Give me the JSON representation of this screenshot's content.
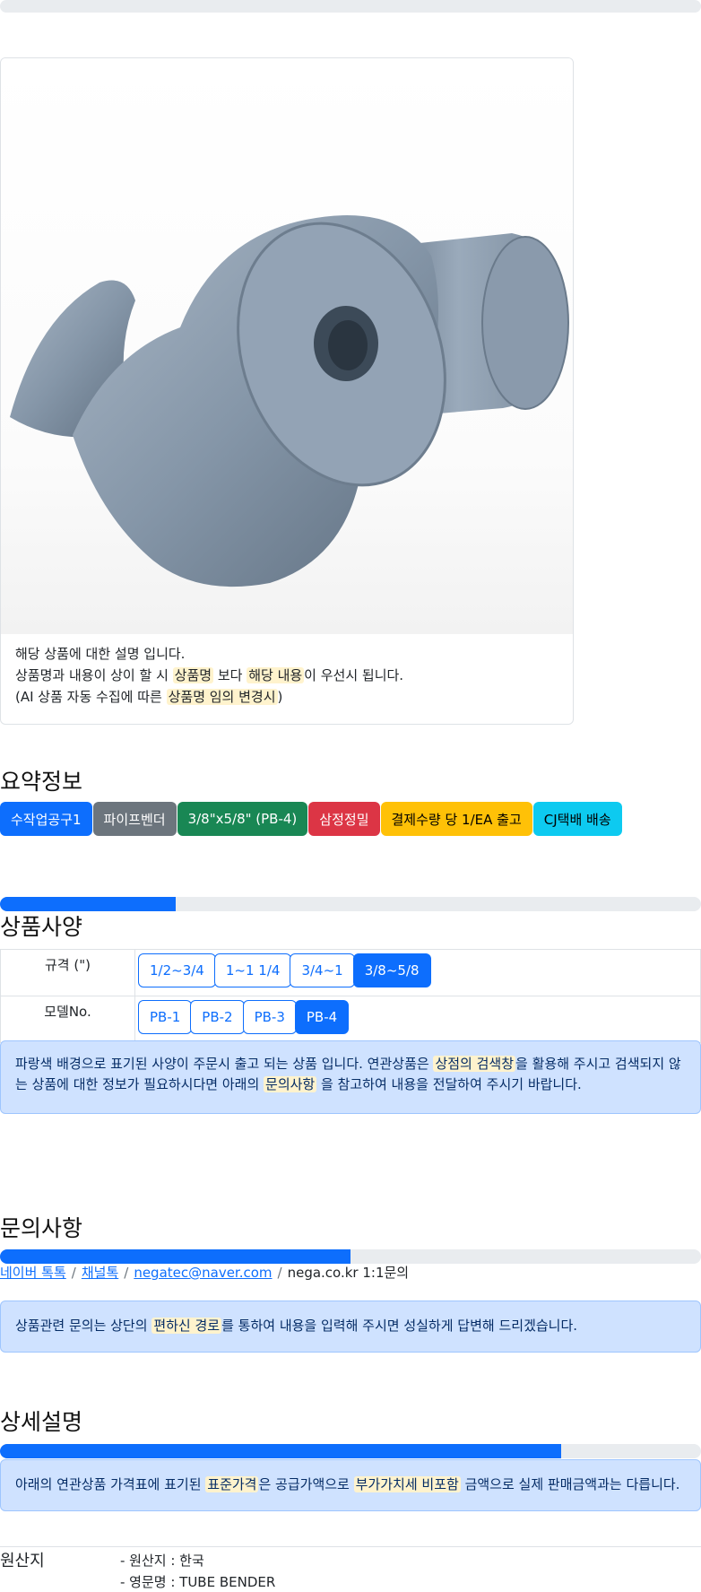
{
  "card": {
    "image_alt": "TUBE BENDER shoe (PB-4)",
    "line1": "해당 상품에 대한 설명 입니다.",
    "line2_a": "상품명과 내용이 상이 할 시 ",
    "line2_hl1": "상품명",
    "line2_b": " 보다 ",
    "line2_hl2": "해당 내용",
    "line2_c": "이 우선시 됩니다.",
    "line3_a": "(AI 상품 자동 수집에 따른 ",
    "line3_hl": "상품명 임의 변경시",
    "line3_b": ")"
  },
  "summary": {
    "title": "요약정보",
    "badges": [
      {
        "label": "수작업공구1",
        "color": "#0d6efd"
      },
      {
        "label": "파이프벤더",
        "color": "#6c757d"
      },
      {
        "label": "3/8\"x5/8\" (PB-4)",
        "color": "#198754"
      },
      {
        "label": "삼정정밀",
        "color": "#dc3545"
      },
      {
        "label": "결제수량 당 1/EA 출고",
        "color": "#ffc107"
      },
      {
        "label": "CJ택배 배송",
        "color": "#0dcaf0"
      }
    ]
  },
  "progress": {
    "top": 0.0,
    "spec": 0.25,
    "inquiry": 0.5,
    "detail": 0.8
  },
  "specs": {
    "title": "상품사양",
    "rows": [
      {
        "label": "규격 (\")",
        "options": [
          "1/2~3/4",
          "1~1 1/4",
          "3/4~1",
          "3/8~5/8"
        ],
        "selected": "3/8~5/8"
      },
      {
        "label": "모델No.",
        "options": [
          "PB-1",
          "PB-2",
          "PB-3",
          "PB-4"
        ],
        "selected": "PB-4"
      }
    ],
    "notice_a": "파랑색 배경으로 표기된 사양이 주문시 출고 되는 상품 입니다. 연관상품은 ",
    "notice_hl1": "상점의 검색창",
    "notice_b": "을 활용해 주시고 검색되지 않는 상품에 대한 정보가 필요하시다면 아래의 ",
    "notice_hl2": "문의사항",
    "notice_c": " 을 참고하여 내용을 전달하여 주시기 바랍니다."
  },
  "inquiry": {
    "title": "문의사항",
    "links": [
      "네이버 톡톡",
      "채널톡",
      "negatec@naver.com"
    ],
    "plain": "nega.co.kr 1:1문의",
    "notice_a": "상품관련 문의는 상단의 ",
    "notice_hl": "편하신 경로",
    "notice_b": "를 통하여 내용을 입력해 주시면 성실하게 답변해 드리겠습니다."
  },
  "detail": {
    "title": "상세설명",
    "notice_a": "아래의 연관상품 가격표에 표기된 ",
    "notice_hl1": "표준가격",
    "notice_b": "은 공급가액으로 ",
    "notice_hl2": "부가가치세 비포함",
    "notice_c": " 금액으로 실제 판매금액과는 다릅니다."
  },
  "origin": {
    "label": "원산지",
    "items": [
      "- 원산지 : 한국",
      "- 영문명 : TUBE BENDER"
    ]
  }
}
